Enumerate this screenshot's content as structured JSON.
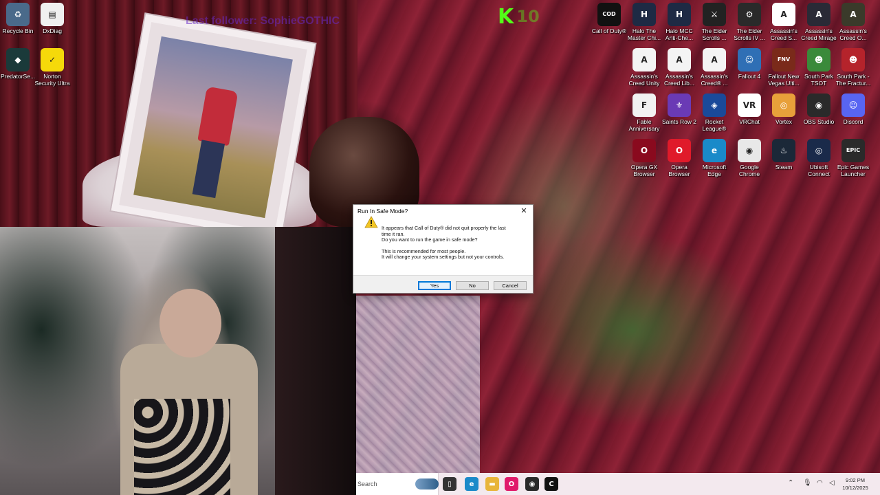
{
  "overlay": {
    "follower_text": "Last follower: SophieGOTHIC",
    "kick_letter": "K",
    "kick_count": "10"
  },
  "desktop_icons_left": [
    {
      "label": "Recycle Bin",
      "icon": "recycle-bin-icon",
      "color": "#4a6a8a",
      "glyph": "♻"
    },
    {
      "label": "DxDiag",
      "icon": "document-icon",
      "color": "#f0f0f0",
      "glyph": "▤"
    },
    {
      "label": "PredatorSe...",
      "icon": "predator-sense-icon",
      "color": "#1a3a3a",
      "glyph": "◆"
    },
    {
      "label": "Norton Security Ultra",
      "icon": "norton-icon",
      "color": "#f5d90a",
      "glyph": "✓"
    }
  ],
  "desktop_icons_right": [
    {
      "label": "Call of Duty®",
      "icon": "call-of-duty-icon",
      "color": "#111111",
      "glyph": "COD"
    },
    {
      "label": "Halo The Master Chi...",
      "icon": "halo-mcc-icon",
      "color": "#1e2a44",
      "glyph": "H"
    },
    {
      "label": "Halo MCC Anti-Che...",
      "icon": "halo-anticheat-icon",
      "color": "#1e2a44",
      "glyph": "H"
    },
    {
      "label": "The Elder Scrolls ...",
      "icon": "elder-scrolls-skyrim-icon",
      "color": "#222222",
      "glyph": "⚔"
    },
    {
      "label": "The Elder Scrolls IV ...",
      "icon": "elder-scrolls-oblivion-icon",
      "color": "#2a2a2a",
      "glyph": "⚙"
    },
    {
      "label": "Assassin's Creed S...",
      "icon": "assassins-creed-icon",
      "color": "#ffffff",
      "glyph": "A"
    },
    {
      "label": "Assassin's Creed Mirage",
      "icon": "assassins-creed-mirage-icon",
      "color": "#2a2a36",
      "glyph": "A"
    },
    {
      "label": "Assassin's Creed O...",
      "icon": "assassins-creed-origins-icon",
      "color": "#3a3a2a",
      "glyph": "A"
    },
    {
      "label": "Assassin's Creed Unity",
      "icon": "assassins-creed-unity-icon",
      "color": "#f4f4f4",
      "glyph": "A"
    },
    {
      "label": "Assassin's Creed Lib...",
      "icon": "assassins-creed-liberation-icon",
      "color": "#f4f4f4",
      "glyph": "A"
    },
    {
      "label": "Assassin's Creed® ...",
      "icon": "assassins-creed-3-icon",
      "color": "#f4f4f4",
      "glyph": "A"
    },
    {
      "label": "Fallout 4",
      "icon": "fallout-4-icon",
      "color": "#2f6fb5",
      "glyph": "☺"
    },
    {
      "label": "Fallout New Vegas Ulti...",
      "icon": "fallout-new-vegas-icon",
      "color": "#7a2a1a",
      "glyph": "FNV"
    },
    {
      "label": "South Park TSOT",
      "icon": "south-park-tsot-icon",
      "color": "#3a8a3a",
      "glyph": "☻"
    },
    {
      "label": "South Park - The Fractur...",
      "icon": "south-park-fractured-icon",
      "color": "#b5232b",
      "glyph": "☻"
    },
    {
      "label": "Fable Anniversary",
      "icon": "fable-icon",
      "color": "#f2f2f2",
      "glyph": "F"
    },
    {
      "label": "Saints Row 2",
      "icon": "saints-row-icon",
      "color": "#6a3ab5",
      "glyph": "⚜"
    },
    {
      "label": "Rocket League®",
      "icon": "rocket-league-icon",
      "color": "#1a4a9a",
      "glyph": "◈"
    },
    {
      "label": "VRChat",
      "icon": "vrchat-icon",
      "color": "#ffffff",
      "glyph": "VR"
    },
    {
      "label": "Vortex",
      "icon": "vortex-icon",
      "color": "#e8a03a",
      "glyph": "◎"
    },
    {
      "label": "OBS Studio",
      "icon": "obs-studio-icon",
      "color": "#2a2a2a",
      "glyph": "◉"
    },
    {
      "label": "Discord",
      "icon": "discord-icon",
      "color": "#5865f2",
      "glyph": "☺"
    },
    {
      "label": "Opera GX Browser",
      "icon": "opera-gx-icon",
      "color": "#8a0a1e",
      "glyph": "O"
    },
    {
      "label": "Opera Browser",
      "icon": "opera-icon",
      "color": "#e01a2a",
      "glyph": "O"
    },
    {
      "label": "Microsoft Edge",
      "icon": "microsoft-edge-icon",
      "color": "#1a8ac9",
      "glyph": "e"
    },
    {
      "label": "Google Chrome",
      "icon": "google-chrome-icon",
      "color": "#e8e8e8",
      "glyph": "◉"
    },
    {
      "label": "Steam",
      "icon": "steam-icon",
      "color": "#1b2838",
      "glyph": "♨"
    },
    {
      "label": "Ubisoft Connect",
      "icon": "ubisoft-connect-icon",
      "color": "#1a2a4a",
      "glyph": "◎"
    },
    {
      "label": "Epic Games Launcher",
      "icon": "epic-games-icon",
      "color": "#2a2a2a",
      "glyph": "EPIC"
    }
  ],
  "dialog": {
    "title": "Run In Safe Mode?",
    "message_line1": "It appears that Call of Duty® did not quit properly the last",
    "message_line2": "time it ran.",
    "message_line3": "Do you want to run the game in safe mode?",
    "message_line4": "This is recommended for most people.",
    "message_line5": "It will change your system settings but not your controls.",
    "yes_label": "Yes",
    "no_label": "No",
    "cancel_label": "Cancel",
    "accent": "#0078d7"
  },
  "taskbar": {
    "search_placeholder": "Search",
    "apps": [
      {
        "icon": "task-view-icon",
        "color": "#333333",
        "glyph": "▯"
      },
      {
        "icon": "microsoft-edge-icon",
        "color": "#1a8ac9",
        "glyph": "e"
      },
      {
        "icon": "file-explorer-icon",
        "color": "#e8b53a",
        "glyph": "▬"
      },
      {
        "icon": "opera-icon",
        "color": "#e01a6a",
        "glyph": "O"
      },
      {
        "icon": "obs-studio-icon",
        "color": "#2a2a2a",
        "glyph": "◉"
      },
      {
        "icon": "call-of-duty-icon",
        "color": "#111111",
        "glyph": "C"
      }
    ],
    "time": "9:02 PM",
    "date": "10/12/2025"
  }
}
